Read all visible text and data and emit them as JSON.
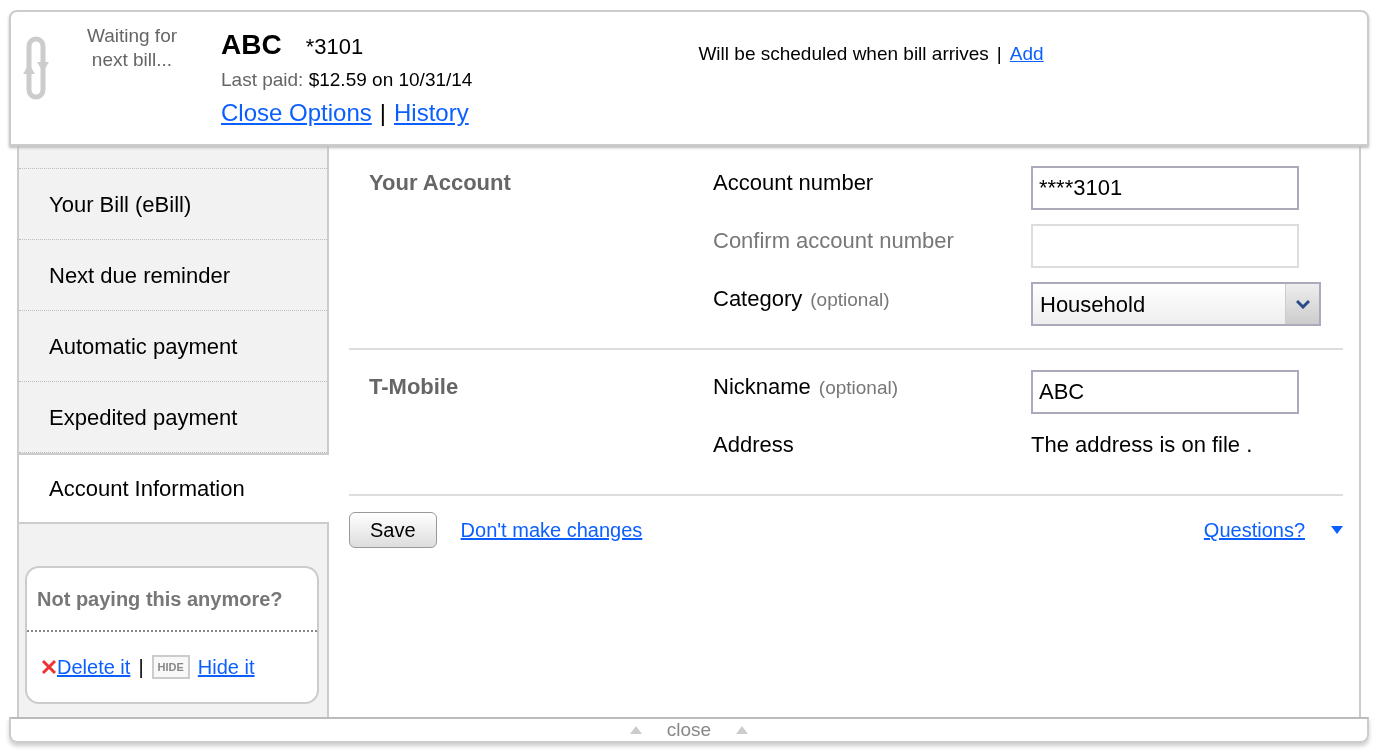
{
  "header": {
    "status": "Waiting for next bill...",
    "name": "ABC",
    "account": "*3101",
    "last_paid_label": "Last paid:",
    "last_paid": "$12.59 on 10/31/14",
    "links": [
      "Close Options",
      "History"
    ],
    "link_separator": "|",
    "schedule_text": "Will be scheduled when bill arrives",
    "schedule_separator": "|",
    "schedule_link": "Add"
  },
  "sidebar": {
    "items": [
      {
        "label": "Your Bill (eBill)",
        "selected": false
      },
      {
        "label": "Next due reminder",
        "selected": false
      },
      {
        "label": "Automatic payment",
        "selected": false
      },
      {
        "label": "Expedited payment",
        "selected": false
      },
      {
        "label": "Account Information",
        "selected": true
      }
    ]
  },
  "side_box": {
    "title": "Not paying this anymore?",
    "delete": "Delete it",
    "separator": "|",
    "hide_badge": "HIDE",
    "hide": "Hide it"
  },
  "sections": [
    {
      "title": "Your Account",
      "fields": [
        {
          "kind": "input",
          "label": "Account number",
          "value": "****3101",
          "disabled": false
        },
        {
          "kind": "input",
          "label": "Confirm account number",
          "disabled": true
        },
        {
          "kind": "select",
          "label": "Category",
          "hint": "(optional)",
          "value": "Household"
        }
      ]
    },
    {
      "title": "T-Mobile",
      "fields": [
        {
          "kind": "input",
          "label": "Nickname",
          "hint": "(optional)",
          "value": "ABC",
          "disabled": false
        },
        {
          "kind": "text",
          "label": "Address",
          "value": "The address is on file ."
        }
      ]
    }
  ],
  "actions": {
    "save": "Save",
    "cancel": "Don't make changes",
    "questions": "Questions?"
  },
  "footer": {
    "close": "close"
  }
}
